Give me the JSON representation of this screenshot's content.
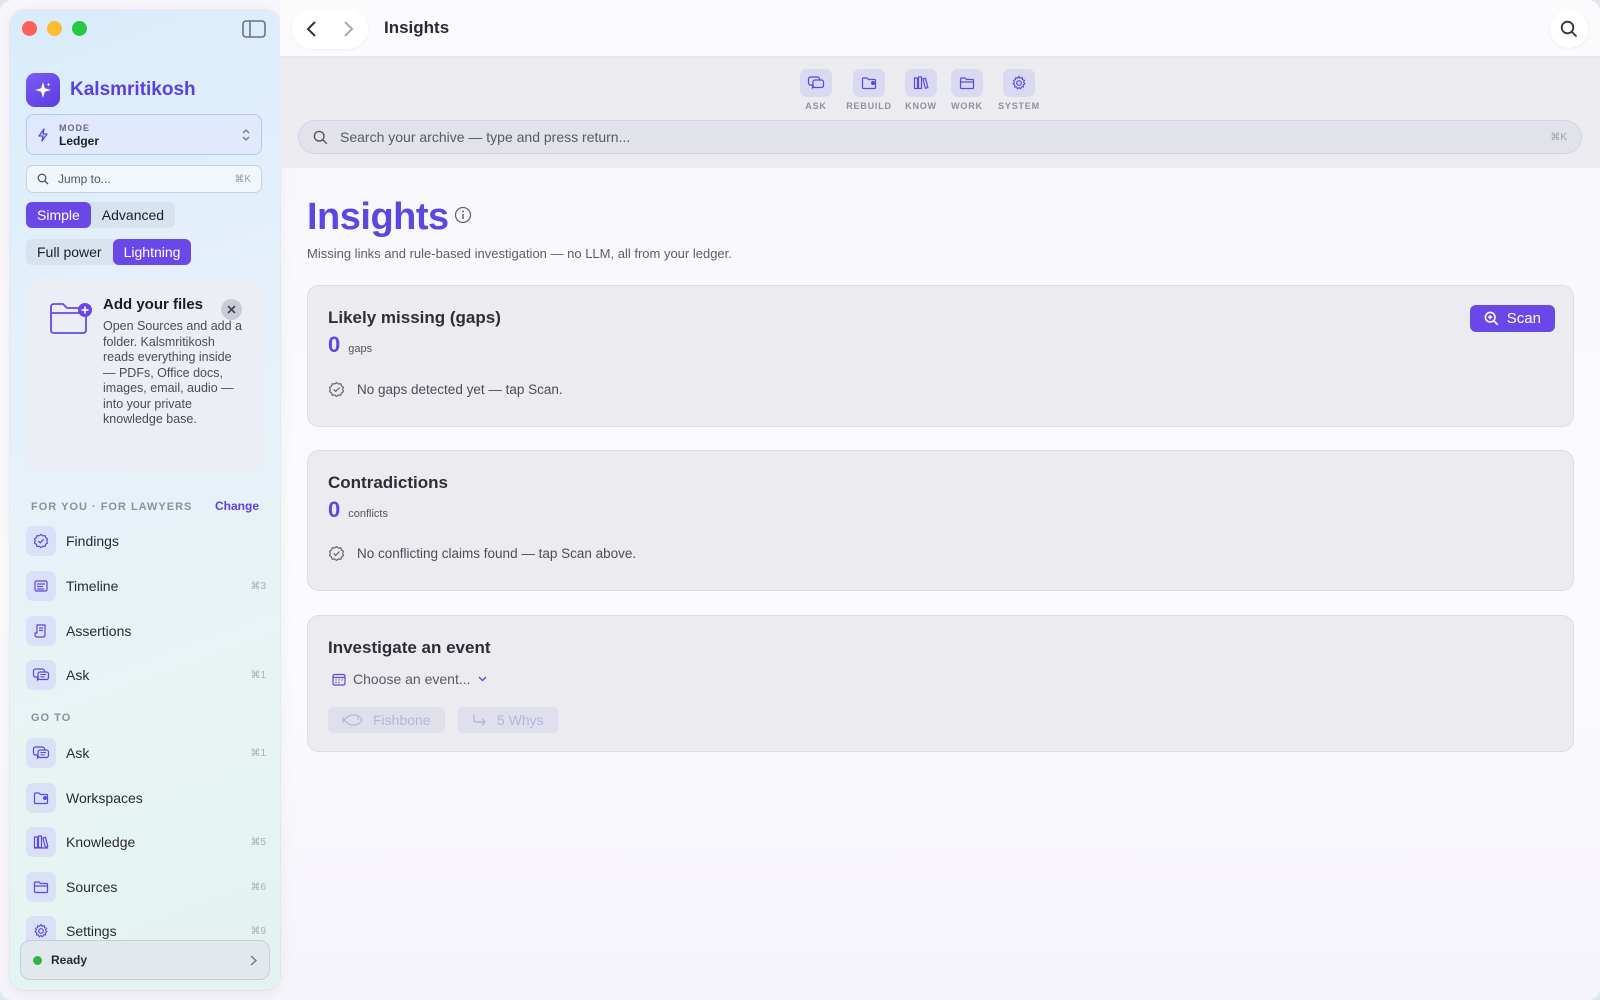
{
  "sidebar": {
    "brand": "Kalsmritikosh",
    "mode": {
      "label": "MODE",
      "value": "Ledger"
    },
    "jump": {
      "placeholder": "Jump to...",
      "shortcut": "⌘K"
    },
    "seg_level": {
      "left": "Simple",
      "right": "Advanced",
      "active": "Simple"
    },
    "seg_power": {
      "left": "Full power",
      "right": "Lightning",
      "active": "Lightning"
    },
    "files_card": {
      "title": "Add your files",
      "body": "Open Sources and add a folder. Kalsmritikosh reads everything inside — PDFs, Office docs, images, email, audio — into your private knowledge base."
    },
    "for_you": {
      "heading": "FOR YOU · FOR LAWYERS",
      "change": "Change",
      "items": [
        {
          "label": "Findings",
          "shortcut": "",
          "icon": "findings-icon"
        },
        {
          "label": "Timeline",
          "shortcut": "⌘3",
          "icon": "timeline-icon"
        },
        {
          "label": "Assertions",
          "shortcut": "",
          "icon": "assertions-icon"
        },
        {
          "label": "Ask",
          "shortcut": "⌘1",
          "icon": "ask-icon"
        }
      ]
    },
    "go_to": {
      "heading": "GO TO",
      "items": [
        {
          "label": "Ask",
          "shortcut": "⌘1",
          "icon": "ask-icon"
        },
        {
          "label": "Workspaces",
          "shortcut": "",
          "icon": "workspaces-icon"
        },
        {
          "label": "Knowledge",
          "shortcut": "⌘5",
          "icon": "knowledge-icon"
        },
        {
          "label": "Sources",
          "shortcut": "⌘6",
          "icon": "sources-icon"
        },
        {
          "label": "Settings",
          "shortcut": "⌘9",
          "icon": "settings-icon"
        }
      ]
    },
    "status": "Ready"
  },
  "topbar": {
    "title": "Insights"
  },
  "toolbar": {
    "tools": [
      {
        "label": "ASK",
        "icon": "ask-icon"
      },
      {
        "label": "REBUILD",
        "icon": "rebuild-icon"
      },
      {
        "label": "KNOW",
        "icon": "know-icon"
      },
      {
        "label": "WORK",
        "icon": "work-icon"
      },
      {
        "label": "SYSTEM",
        "icon": "system-icon"
      }
    ],
    "search_placeholder": "Search your archive — type and press return...",
    "search_shortcut": "⌘K"
  },
  "main": {
    "title": "Insights",
    "subtitle": "Missing links and rule-based investigation — no LLM, all from your ledger.",
    "gaps": {
      "title": "Likely missing (gaps)",
      "count": "0",
      "unit": "gaps",
      "message": "No gaps detected yet — tap Scan.",
      "scan": "Scan"
    },
    "contradictions": {
      "title": "Contradictions",
      "count": "0",
      "unit": "conflicts",
      "message": "No conflicting claims found — tap Scan above."
    },
    "investigate": {
      "title": "Investigate an event",
      "choose": "Choose an event...",
      "fishbone": "Fishbone",
      "whys": "5 Whys"
    }
  },
  "colors": {
    "accent": "#6a48e8",
    "status_ok": "#2fb344"
  }
}
